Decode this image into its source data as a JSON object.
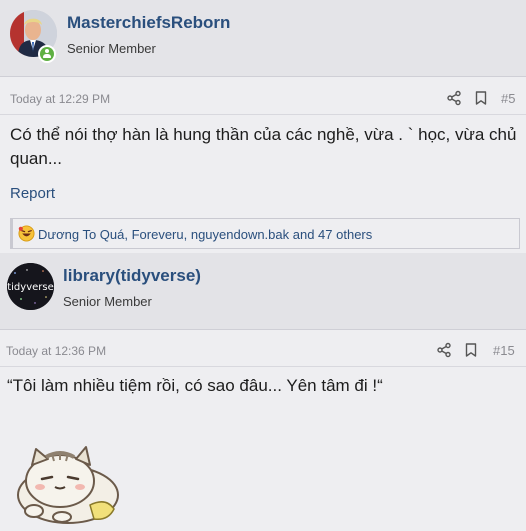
{
  "posts": [
    {
      "username": "MasterchiefsReborn",
      "user_title": "Senior Member",
      "timestamp": "Today at 12:29 PM",
      "post_number": "#5",
      "body": "Có thể nói thợ hàn là hung thần của các nghề, vừa . ` học, vừa chủ quan...",
      "report_label": "Report",
      "reactions_text": "Dương To Quá, Foreveru, nguyendown.bak and 47 others"
    },
    {
      "username": "library(tidyverse)",
      "user_title": "Senior Member",
      "avatar_text": "tidyverse",
      "timestamp": "Today at 12:36 PM",
      "post_number": "#15",
      "body": "“Tôi làm nhiều tiệm rồi, có sao đâu... Yên tâm đi !“"
    }
  ],
  "icons": {
    "share": "share-icon",
    "bookmark": "bookmark-icon",
    "online": "online-status-icon",
    "reaction": "haha-reaction-icon"
  },
  "colors": {
    "accent": "#2a4f7d",
    "online": "#5fb043"
  }
}
